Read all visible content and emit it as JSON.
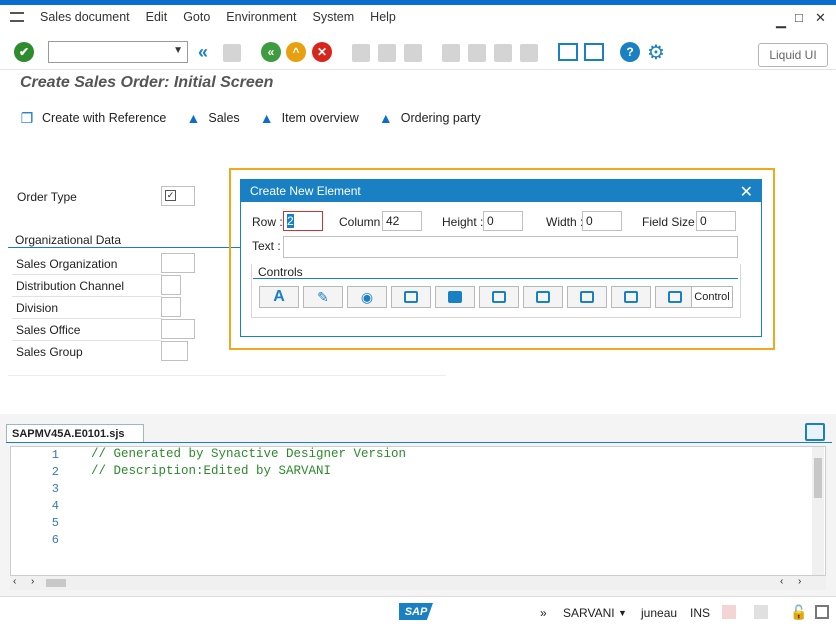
{
  "menubar": {
    "items": [
      "Sales document",
      "Edit",
      "Goto",
      "Environment",
      "System",
      "Help"
    ]
  },
  "toolbar": {
    "liquid_ui_label": "Liquid UI"
  },
  "page": {
    "title": "Create Sales Order: Initial Screen"
  },
  "appbar": {
    "buttons": [
      "Create with Reference",
      "Sales",
      "Item overview",
      "Ordering party"
    ]
  },
  "form": {
    "order_type_label": "Order Type",
    "org_group_title": "Organizational Data",
    "fields": [
      "Sales Organization",
      "Distribution Channel",
      "Division",
      "Sales Office",
      "Sales Group"
    ]
  },
  "dialog": {
    "title": "Create New Element",
    "row_label": "Row :",
    "row_value": "2",
    "column_label": "Column :",
    "column_value": "42",
    "height_label": "Height :",
    "height_value": "0",
    "width_label": "Width :",
    "width_value": "0",
    "fieldsize_label": "Field Size :",
    "fieldsize_value": "0",
    "text_label": "Text :",
    "text_value": "",
    "controls_title": "Controls",
    "control_button_label": "Control"
  },
  "editor": {
    "tab_label": "SAPMV45A.E0101.sjs",
    "line_numbers": [
      "1",
      "2",
      "3",
      "4",
      "5",
      "6"
    ],
    "lines": [
      "// Generated by Synactive Designer Version",
      "// Description:Edited by SARVANI",
      "",
      "",
      "",
      ""
    ]
  },
  "status": {
    "user": "SARVANI",
    "server": "juneau",
    "mode": "INS",
    "logo_text": "SAP",
    "expand": "»"
  },
  "colors": {
    "accent": "#1a80c4",
    "highlight": "#f0a81c",
    "ok_green": "#2e8b2e",
    "cancel_red": "#d9261c",
    "nav_green": "#3e9b3e",
    "nav_orange": "#e8a010"
  }
}
